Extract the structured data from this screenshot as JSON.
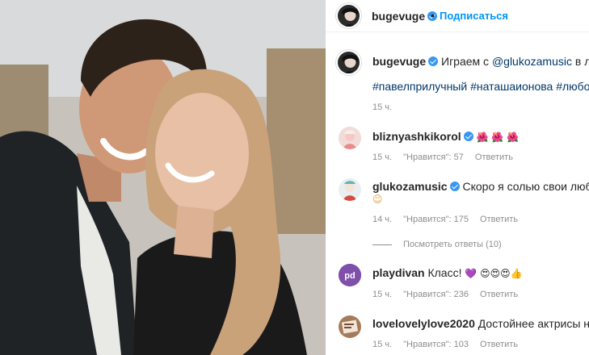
{
  "post": {
    "author": "bugevuge",
    "follow_label": "Подписаться",
    "separator": "•",
    "caption": {
      "username": "bugevuge",
      "text_before": "Играем с ",
      "mention": "@glukozamusic",
      "text_after": " в любовь.",
      "hashtags": "#павелприлучный #наташаионова #любовницы",
      "time": "15 ч."
    }
  },
  "comments": [
    {
      "username": "bliznyashkikorol",
      "text": "",
      "emoji": "🌺 🌺 🌺",
      "time": "15 ч.",
      "likes": "\"Нравится\": 57",
      "reply": "Ответить"
    },
    {
      "username": "glukozamusic",
      "text": "Скоро я солью свои любимые с",
      "emoji": "☺",
      "time": "14 ч.",
      "likes": "\"Нравится\": 175",
      "reply": "Ответить",
      "view_replies": "Посмотреть ответы (10)"
    },
    {
      "username": "playdivan",
      "text": "Класс!",
      "emoji": "💜 😍😍😍👍",
      "time": "15 ч.",
      "likes": "\"Нравится\": 236",
      "reply": "Ответить"
    },
    {
      "username": "lovelovelylove2020",
      "text": "Достойнее актрисы не нашло",
      "time": "15 ч.",
      "likes": "\"Нравится\": 103",
      "reply": "Ответить"
    }
  ],
  "colors": {
    "accent": "#0095f6",
    "verified": "#3897f0",
    "muted": "#8e8e8e",
    "link": "#00376b"
  },
  "icons": [
    "verified-badge-icon"
  ]
}
